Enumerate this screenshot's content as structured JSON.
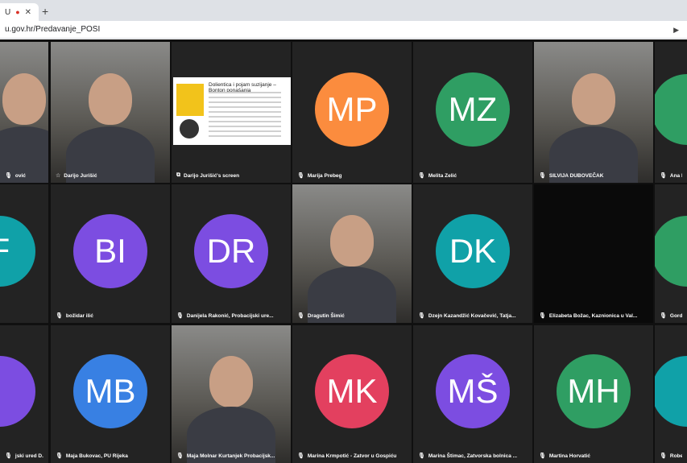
{
  "browser": {
    "tab_title": "U",
    "tab_recording_icon": "record-dot-icon",
    "tab_close_icon": "close-icon",
    "new_tab_label": "+",
    "url": "u.gov.hr/Predavanje_POSI"
  },
  "colors": {
    "orange": "#fb8c3e",
    "green": "#2f9e63",
    "purple": "#7c4de1",
    "teal": "#10a1a8",
    "blue": "#3880e3",
    "red": "#e3405f",
    "active_border": "#1a73e8"
  },
  "participants": [
    {
      "name": "ović",
      "kind": "video",
      "row": 0,
      "col": 0
    },
    {
      "name": "Darijo Jurišić",
      "kind": "video",
      "row": 0,
      "col": 1,
      "active": true
    },
    {
      "name": "Darijo Jurišić's screen",
      "kind": "screen",
      "row": 0,
      "col": 2
    },
    {
      "name": "Marija Prebeg",
      "initials": "MP",
      "color": "#fb8c3e",
      "row": 0,
      "col": 3
    },
    {
      "name": "Melita Zelić",
      "initials": "MZ",
      "color": "#2f9e63",
      "row": 0,
      "col": 4
    },
    {
      "name": "SILVIJA DUBOVEČAK",
      "kind": "video",
      "row": 0,
      "col": 5
    },
    {
      "name": "Ana B",
      "initials": "",
      "color": "#2f9e63",
      "row": 0,
      "col": 6
    },
    {
      "name": "",
      "initials": "F",
      "color": "#10a1a8",
      "row": 1,
      "col": 0
    },
    {
      "name": "božidar ilić",
      "initials": "BI",
      "color": "#7c4de1",
      "row": 1,
      "col": 1
    },
    {
      "name": "Danijela Rakonić, Probacijski ure...",
      "initials": "DR",
      "color": "#7c4de1",
      "row": 1,
      "col": 2
    },
    {
      "name": "Dragutin Šimić",
      "kind": "video",
      "row": 1,
      "col": 3
    },
    {
      "name": "Dzejn Kazandžić Kovačević, Tatja...",
      "initials": "DK",
      "color": "#10a1a8",
      "row": 1,
      "col": 4
    },
    {
      "name": "Elizabeta Božac, Kaznionica u Val...",
      "kind": "blank",
      "row": 1,
      "col": 5
    },
    {
      "name": "Gorda",
      "initials": "",
      "color": "#2f9e63",
      "row": 1,
      "col": 6
    },
    {
      "name": "jski ured D...",
      "initials": "",
      "color": "#7c4de1",
      "row": 2,
      "col": 0
    },
    {
      "name": "Maja Bukovac, PU Rijeka",
      "initials": "MB",
      "color": "#3880e3",
      "row": 2,
      "col": 1
    },
    {
      "name": "Maja Molnar Kurtanjek Probacijsk...",
      "kind": "video",
      "row": 2,
      "col": 2
    },
    {
      "name": "Marina Krmpotić - Zatvor u Gospiću",
      "initials": "MK",
      "color": "#e3405f",
      "row": 2,
      "col": 3
    },
    {
      "name": "Marina Štimac, Zatvorska bolnica ...",
      "initials": "MŠ",
      "color": "#7c4de1",
      "row": 2,
      "col": 4
    },
    {
      "name": "Martina Horvatić",
      "initials": "MH",
      "color": "#2f9e63",
      "row": 2,
      "col": 5
    },
    {
      "name": "Rober",
      "initials": "",
      "color": "#10a1a8",
      "row": 2,
      "col": 6
    }
  ],
  "screenshare": {
    "title": "Dolientica i pojam suzijanje – Bonton ponašanja"
  }
}
